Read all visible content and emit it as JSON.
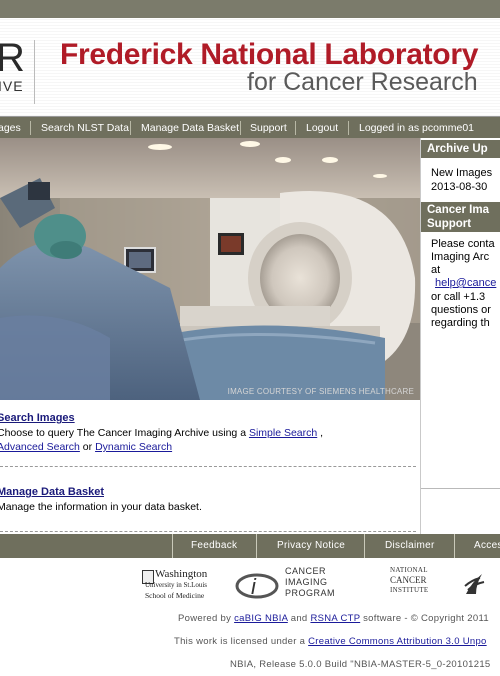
{
  "header": {
    "logo_left": "R",
    "logo_left_sub": "IVE",
    "org_title": "Frederick National Laboratory",
    "org_subtitle": "for Cancer Research"
  },
  "nav": {
    "items": [
      "ages",
      "Search NLST Data",
      "Manage Data Basket",
      "Support",
      "Logout"
    ],
    "logged_in": "Logged in as pcomme01"
  },
  "hero": {
    "credit": "IMAGE COURTESY OF SIEMENS HEALTHCARE"
  },
  "main": {
    "search": {
      "title": "Search Images",
      "text_prefix": "Choose to query The Cancer Imaging Archive using a ",
      "simple_link": "Simple Search",
      "text_comma": " ,",
      "advanced_link": "Advanced Search",
      "text_or": " or ",
      "dynamic_link": "Dynamic Search"
    },
    "basket": {
      "title": "Manage Data Basket",
      "text": "Manage the information in your data basket."
    }
  },
  "sidebar": {
    "update_title": "Archive Up",
    "update_line1": "New Images",
    "update_date": "2013-08-30",
    "support_title_1": "Cancer Ima",
    "support_title_2": "Support",
    "support_lines": [
      "Please conta",
      "Imaging Arc",
      "at"
    ],
    "support_email": "help@cance",
    "support_more": [
      " or call +1.3",
      "questions or",
      "regarding th"
    ]
  },
  "footer": {
    "feedback": "Feedback",
    "privacy": "Privacy Notice",
    "disclaimer": "Disclaimer",
    "access": "Access"
  },
  "partners": {
    "wustl_1": "Washington",
    "wustl_2": "University in St.Louis",
    "wustl_3": "School of Medicine",
    "cip_1": "CANCER",
    "cip_2": "IMAGING",
    "cip_3": "PROGRAM",
    "nci_1": "NATIONAL",
    "nci_2": "CANCER",
    "nci_3": "INSTITUTE"
  },
  "credits": {
    "powered_prefix": "Powered by ",
    "cabig_link": "caBIG NBIA",
    "and": " and ",
    "rsna_link": "RSNA CTP",
    "powered_suffix": " software - © Copyright 2011",
    "license_prefix": "This work is licensed under a ",
    "license_link": "Creative Commons Attribution 3.0 Unpo",
    "release": "NBIA, Release 5.0.0 Build \"NBIA-MASTER-5_0-20101215"
  }
}
